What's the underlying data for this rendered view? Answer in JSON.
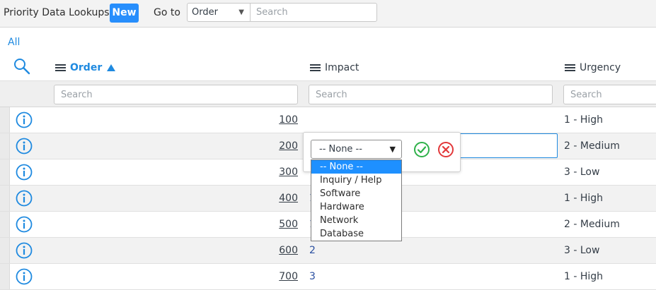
{
  "header": {
    "title": "Priority Data Lookups",
    "new_label": "New",
    "goto_label": "Go to",
    "goto_select_value": "Order",
    "goto_search_placeholder": "Search"
  },
  "breadcrumb": "All",
  "columns": {
    "order": "Order",
    "impact": "Impact",
    "urgency": "Urgency"
  },
  "column_search_placeholder": "Search",
  "rows": [
    {
      "order": "100",
      "impact": "",
      "urgency": "1 - High"
    },
    {
      "order": "200",
      "impact": "",
      "urgency": "2 - Medium"
    },
    {
      "order": "300",
      "impact": "",
      "urgency": "3 - Low"
    },
    {
      "order": "400",
      "impact": "1",
      "urgency": "1 - High"
    },
    {
      "order": "500",
      "impact": "1",
      "urgency": "2 - Medium"
    },
    {
      "order": "600",
      "impact": "2",
      "urgency": "3 - Low"
    },
    {
      "order": "700",
      "impact": "3",
      "urgency": "1 - High"
    }
  ],
  "inline_editor": {
    "selected_value": "-- None --",
    "options": [
      "-- None --",
      "Inquiry / Help",
      "Software",
      "Hardware",
      "Network",
      "Database"
    ]
  },
  "icons": {
    "search": "search-icon",
    "info": "info-circle-icon",
    "ok": "check-circle-icon",
    "cancel": "x-circle-icon",
    "sort": "sort-ascending-icon",
    "column_menu": "hamburger-icon"
  },
  "colors": {
    "accent": "#278efc",
    "link": "#1f8ae0",
    "ok_green": "#2fb14a",
    "cancel_red": "#e2383a",
    "dropdown_highlight": "#1e90ff"
  }
}
